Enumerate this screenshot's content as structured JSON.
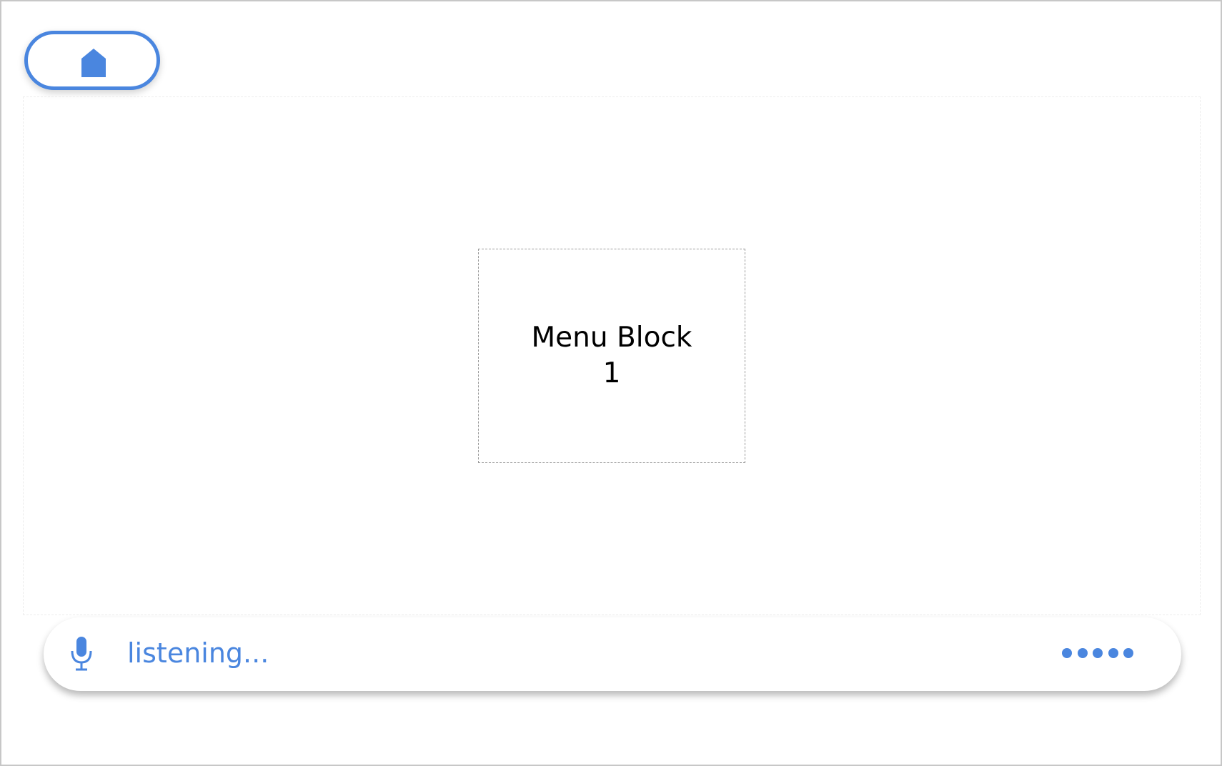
{
  "app": {
    "accent_color": "#4a86df"
  },
  "header": {
    "home_button_icon": "home-icon"
  },
  "main": {
    "menu_block": {
      "line1": "Menu Block",
      "line2": "1"
    }
  },
  "voice_bar": {
    "mic_icon": "microphone-icon",
    "status_text": "listening...",
    "indicator_icon": "dots-icon"
  }
}
